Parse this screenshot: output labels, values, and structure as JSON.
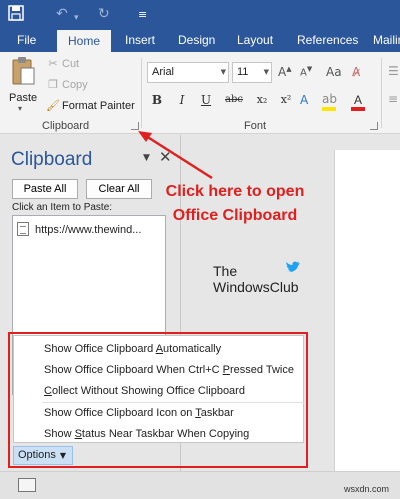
{
  "quick_access": {
    "save_icon": "save-icon",
    "undo_icon": "undo-icon",
    "redo_icon": "redo-icon",
    "customize_icon": "chevron-down-icon"
  },
  "tabs": [
    {
      "label": "File"
    },
    {
      "label": "Home",
      "active": true
    },
    {
      "label": "Insert"
    },
    {
      "label": "Design"
    },
    {
      "label": "Layout"
    },
    {
      "label": "References"
    },
    {
      "label": "Mailin"
    }
  ],
  "clipboard_group": {
    "paste": "Paste",
    "cut": "Cut",
    "copy": "Copy",
    "format_painter": "Format Painter",
    "label": "Clipboard"
  },
  "font_group": {
    "font_name": "Arial",
    "font_size": "11",
    "label": "Font",
    "bold": "B",
    "italic": "I",
    "underline": "U",
    "strike": "abc",
    "subscript": "x₂",
    "superscript": "x²",
    "font_color": "A"
  },
  "pane": {
    "title": "Clipboard",
    "paste_all": "Paste All",
    "clear_all": "Clear All",
    "click_label": "Click an Item to Paste:",
    "items": [
      "https://www.thewind..."
    ],
    "options": "Options"
  },
  "options_menu": [
    {
      "pre": "Show Office Clipboard ",
      "key": "A",
      "post": "utomatically"
    },
    {
      "pre": "Show Office Clipboard When Ctrl+C ",
      "key": "P",
      "post": "ressed Twice"
    },
    {
      "pre": "",
      "key": "C",
      "post": "ollect Without Showing Office Clipboard"
    },
    {
      "pre": "Show Office Clipboard Icon on ",
      "key": "T",
      "post": "askbar"
    },
    {
      "pre": "Show ",
      "key": "S",
      "post": "tatus Near Taskbar When Copying"
    }
  ],
  "annotation": {
    "line1": "Click here to open",
    "line2": "Office Clipboard"
  },
  "watermark": {
    "line1": "The",
    "line2": "WindowsClub",
    "site": "wsxdn.com"
  },
  "colors": {
    "brand": "#2b579a",
    "annotation": "#e0201f"
  }
}
